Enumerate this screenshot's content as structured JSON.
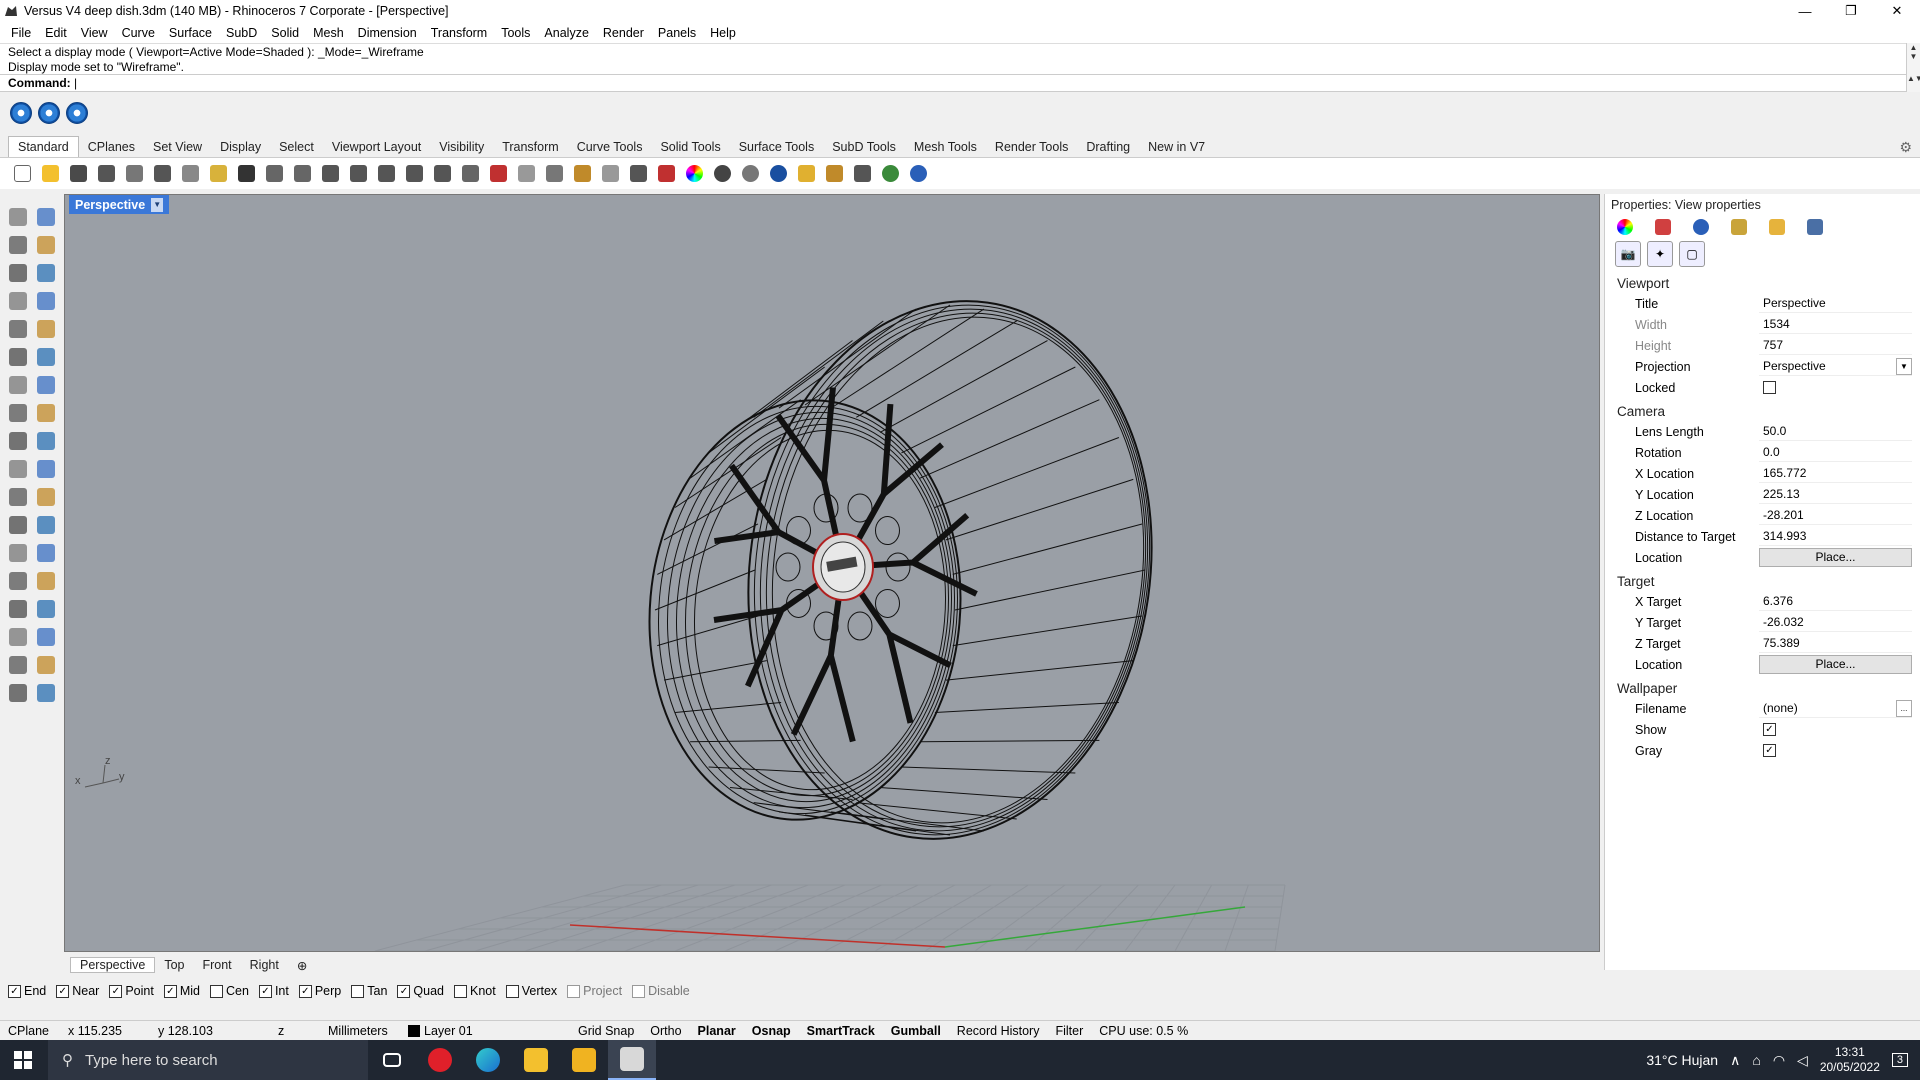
{
  "window": {
    "title": "Versus V4 deep dish.3dm (140 MB) - Rhinoceros 7 Corporate - [Perspective]",
    "minimize": "—",
    "maximize": "❐",
    "close": "✕"
  },
  "menu": [
    "File",
    "Edit",
    "View",
    "Curve",
    "Surface",
    "SubD",
    "Solid",
    "Mesh",
    "Dimension",
    "Transform",
    "Tools",
    "Analyze",
    "Render",
    "Panels",
    "Help"
  ],
  "command_history": [
    "Select a display mode ( Viewport=Active  Mode=Shaded ): _Mode=_Wireframe",
    "Display mode set to \"Wireframe\"."
  ],
  "command_prompt": "Command:",
  "toolbar_tabs": [
    "Standard",
    "CPlanes",
    "Set View",
    "Display",
    "Select",
    "Viewport Layout",
    "Visibility",
    "Transform",
    "Curve Tools",
    "Solid Tools",
    "Surface Tools",
    "SubD Tools",
    "Mesh Tools",
    "Render Tools",
    "Drafting",
    "New in V7"
  ],
  "active_tab": "Standard",
  "viewport": {
    "title": "Perspective",
    "dropdown": "▼",
    "axes": {
      "x": "x",
      "y": "y",
      "z": "z"
    }
  },
  "view_tabs": [
    "Perspective",
    "Top",
    "Front",
    "Right"
  ],
  "view_tab_add": "⊕",
  "osnaps": [
    {
      "label": "End",
      "checked": true
    },
    {
      "label": "Near",
      "checked": true
    },
    {
      "label": "Point",
      "checked": true
    },
    {
      "label": "Mid",
      "checked": true
    },
    {
      "label": "Cen",
      "checked": false
    },
    {
      "label": "Int",
      "checked": true
    },
    {
      "label": "Perp",
      "checked": true
    },
    {
      "label": "Tan",
      "checked": false
    },
    {
      "label": "Quad",
      "checked": true
    },
    {
      "label": "Knot",
      "checked": false
    },
    {
      "label": "Vertex",
      "checked": false
    }
  ],
  "osnap_extra": [
    {
      "label": "Project",
      "checked": false
    },
    {
      "label": "Disable",
      "checked": false
    }
  ],
  "status": {
    "cplane": "CPlane",
    "x": "x 115.235",
    "y": "y 128.103",
    "z": "z",
    "units": "Millimeters",
    "layer": "Layer 01",
    "grid_snap": "Grid Snap",
    "ortho": "Ortho",
    "planar": "Planar",
    "osnap": "Osnap",
    "smarttrack": "SmartTrack",
    "gumball": "Gumball",
    "record_history": "Record History",
    "filter": "Filter",
    "cpu": "CPU use: 0.5 %"
  },
  "properties": {
    "header": "Properties: View properties",
    "viewport_section": "Viewport",
    "viewport_rows": [
      {
        "k": "Title",
        "v": "Perspective",
        "dim": false
      },
      {
        "k": "Width",
        "v": "1534",
        "dim": true
      },
      {
        "k": "Height",
        "v": "757",
        "dim": true
      },
      {
        "k": "Projection",
        "v": "Perspective",
        "dim": false,
        "dropdown": true
      },
      {
        "k": "Locked",
        "checkbox": false
      }
    ],
    "camera_section": "Camera",
    "camera_rows": [
      {
        "k": "Lens Length",
        "v": "50.0"
      },
      {
        "k": "Rotation",
        "v": "0.0"
      },
      {
        "k": "X Location",
        "v": "165.772"
      },
      {
        "k": "Y Location",
        "v": "225.13"
      },
      {
        "k": "Z Location",
        "v": "-28.201"
      },
      {
        "k": "Distance to Target",
        "v": "314.993"
      },
      {
        "k": "Location",
        "button": "Place..."
      }
    ],
    "target_section": "Target",
    "target_rows": [
      {
        "k": "X Target",
        "v": "6.376"
      },
      {
        "k": "Y Target",
        "v": "-26.032"
      },
      {
        "k": "Z Target",
        "v": "75.389"
      },
      {
        "k": "Location",
        "button": "Place..."
      }
    ],
    "wallpaper_section": "Wallpaper",
    "wallpaper_rows": [
      {
        "k": "Filename",
        "v": "(none)",
        "browse": "..."
      },
      {
        "k": "Show",
        "checkbox": true
      },
      {
        "k": "Gray",
        "checkbox": true
      }
    ]
  },
  "taskbar": {
    "search_placeholder": "Type here to search",
    "weather": "31°C  Hujan",
    "time": "13:31",
    "date": "20/05/2022",
    "notifications": "3"
  },
  "colors": {
    "viewport_bg": "#9a9fa6",
    "active_tab": "#3b78d8",
    "taskbar": "#1f2631"
  }
}
